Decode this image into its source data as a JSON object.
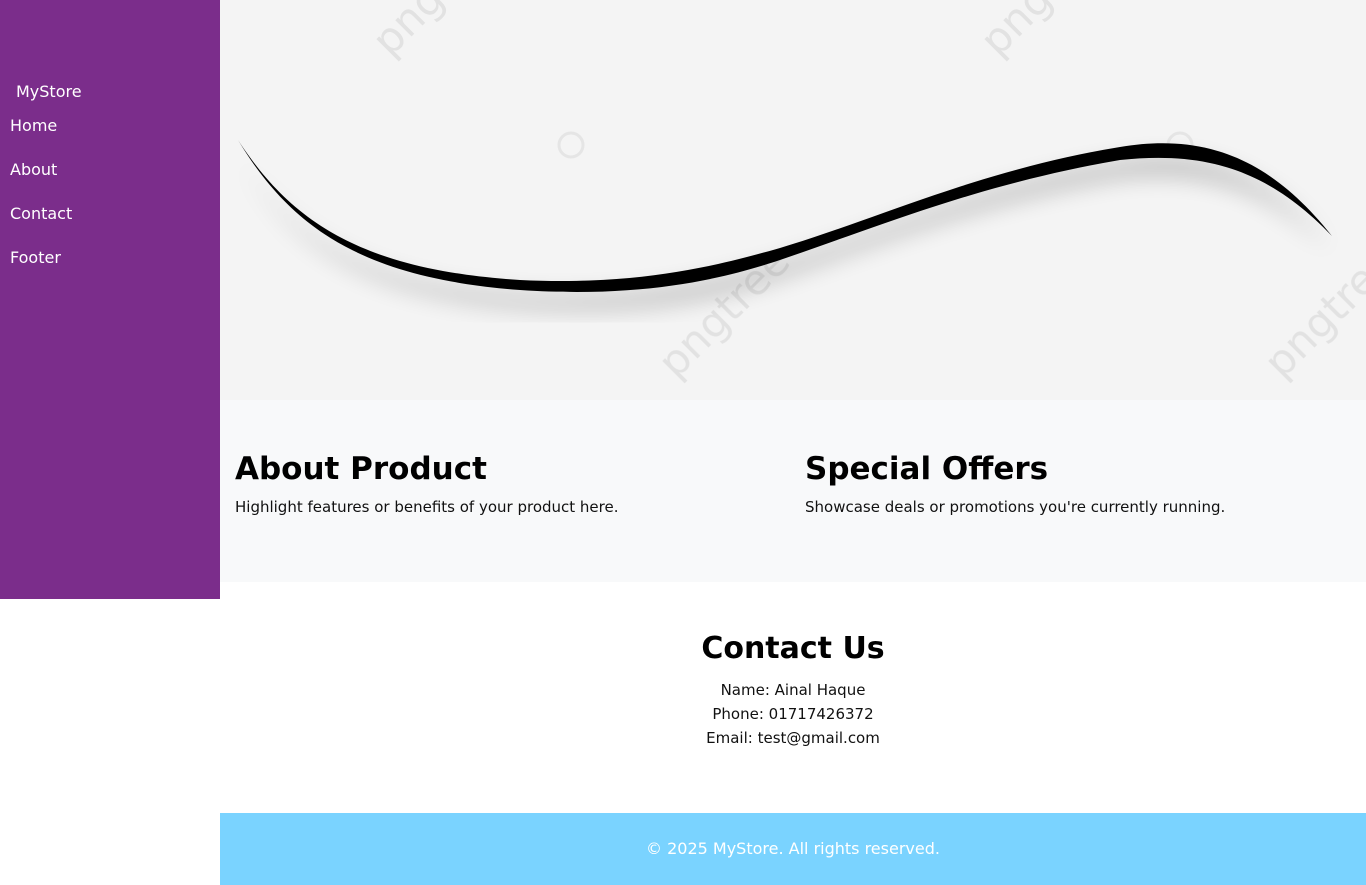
{
  "sidebar": {
    "brand": "MyStore",
    "items": [
      {
        "label": "Home"
      },
      {
        "label": "About"
      },
      {
        "label": "Contact"
      },
      {
        "label": "Footer"
      }
    ]
  },
  "hero": {
    "watermark": "pngtree"
  },
  "features": [
    {
      "title": "About Product",
      "text": "Highlight features or benefits of your product here."
    },
    {
      "title": "Special Offers",
      "text": "Showcase deals or promotions you're currently running."
    }
  ],
  "contact": {
    "title": "Contact Us",
    "name": "Name: Ainal Haque",
    "phone": "Phone: 01717426372",
    "email": "Email: test@gmail.com"
  },
  "footer": {
    "text": "© 2025 MyStore. All rights reserved."
  },
  "colors": {
    "sidebar": "#7b2d8b",
    "footer": "#7ad3ff",
    "hero": "#f4f4f4"
  }
}
